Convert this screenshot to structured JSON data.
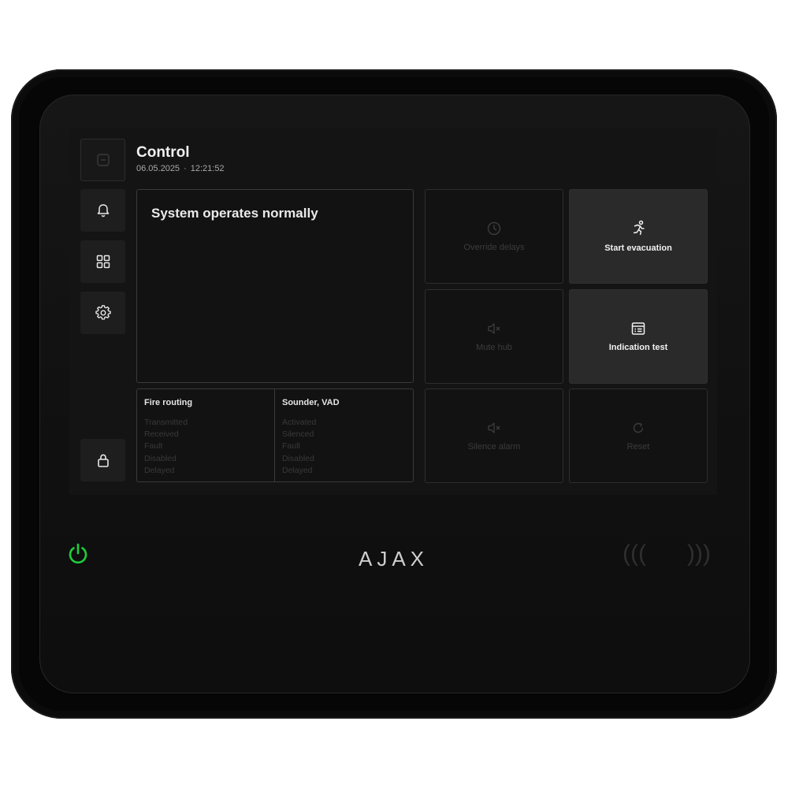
{
  "header": {
    "title": "Control",
    "date": "06.05.2025",
    "separator": "·",
    "time": "12:21:52"
  },
  "sidebar": {
    "items": [
      {
        "icon": "home-square-icon"
      },
      {
        "icon": "bell-icon"
      },
      {
        "icon": "grid-icon"
      },
      {
        "icon": "gear-icon"
      },
      {
        "icon": "lock-icon"
      }
    ]
  },
  "status": {
    "text": "System operates normally"
  },
  "fire_routing": {
    "title": "Fire routing",
    "items": [
      "Transmitted",
      "Received",
      "Fault",
      "Disabled",
      "Delayed"
    ]
  },
  "sounder": {
    "title": "Sounder, VAD",
    "items": [
      "Activated",
      "Silenced",
      "Fault",
      "Disabled",
      "Delayed"
    ]
  },
  "actions": {
    "override_delays": "Override delays",
    "start_evacuation": "Start evacuation",
    "mute_hub": "Mute hub",
    "indication_test": "Indication test",
    "silence_alarm": "Silence alarm",
    "reset": "Reset"
  },
  "device": {
    "logo": "AJAX",
    "power_icon": "power-icon",
    "power_color": "#1ecf3a",
    "nfc_left": "(((",
    "nfc_right": ")))"
  }
}
